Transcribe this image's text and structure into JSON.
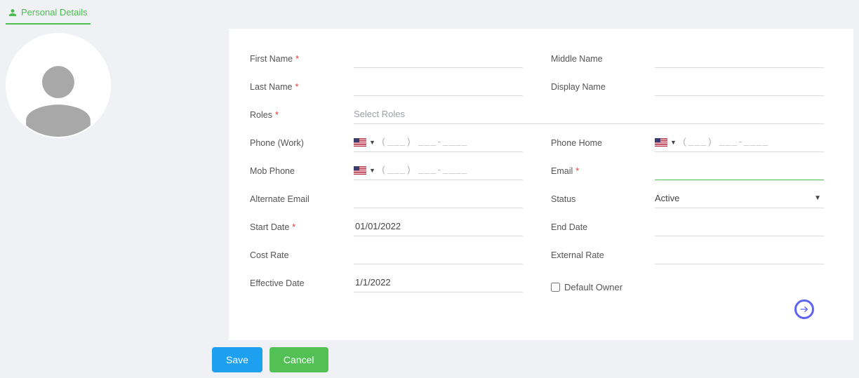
{
  "tab": {
    "label": "Personal Details",
    "icon": "person-icon"
  },
  "form": {
    "first_name": {
      "label": "First Name",
      "value": "",
      "required": true
    },
    "middle_name": {
      "label": "Middle Name",
      "value": ""
    },
    "last_name": {
      "label": "Last Name",
      "value": "",
      "required": true
    },
    "display_name": {
      "label": "Display Name",
      "value": ""
    },
    "roles": {
      "label": "Roles",
      "placeholder": "Select Roles",
      "required": true
    },
    "phone_work": {
      "label": "Phone (Work)",
      "mask": "(___) ___-____",
      "country": "US"
    },
    "phone_home": {
      "label": "Phone Home",
      "mask": "(___) ___-____",
      "country": "US"
    },
    "mob_phone": {
      "label": "Mob Phone",
      "mask": "(___) ___-____",
      "country": "US"
    },
    "email": {
      "label": "Email",
      "value": "",
      "required": true
    },
    "alt_email": {
      "label": "Alternate Email",
      "value": ""
    },
    "status": {
      "label": "Status",
      "value": "Active"
    },
    "start_date": {
      "label": "Start Date",
      "value": "01/01/2022",
      "required": true
    },
    "end_date": {
      "label": "End Date",
      "value": ""
    },
    "cost_rate": {
      "label": "Cost Rate",
      "value": ""
    },
    "external_rate": {
      "label": "External Rate",
      "value": ""
    },
    "effective_date": {
      "label": "Effective Date",
      "value": "1/1/2022"
    },
    "default_owner": {
      "label": "Default Owner",
      "checked": false
    }
  },
  "actions": {
    "save": "Save",
    "cancel": "Cancel"
  }
}
